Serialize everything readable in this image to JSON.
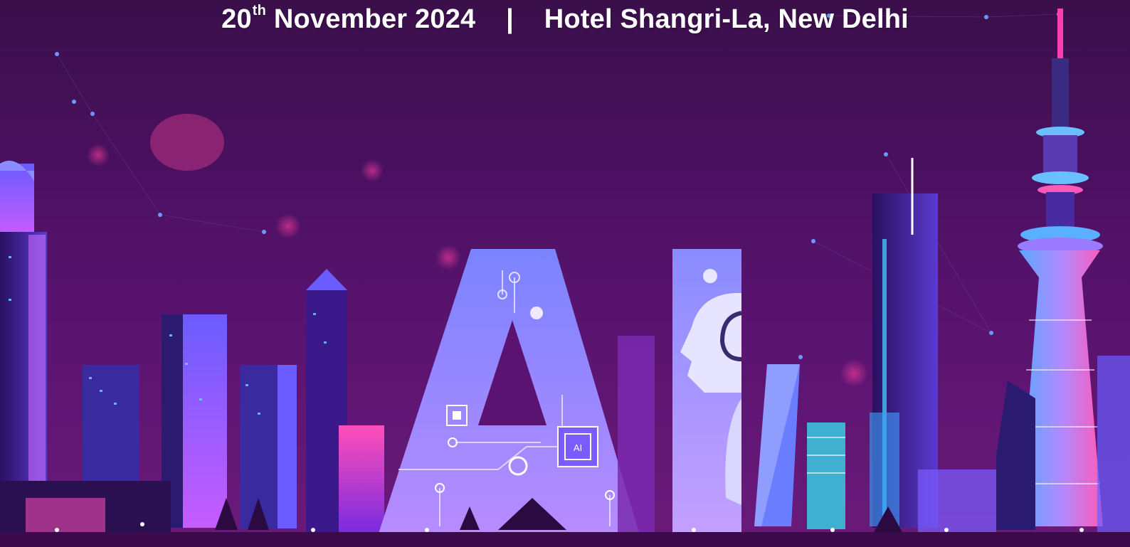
{
  "banner": {
    "date_day": "20",
    "date_suffix": "th",
    "date_rest": "November 2024",
    "separator": "|",
    "venue": "Hotel Shangri-La, New Delhi"
  },
  "artwork": {
    "big_letters": "AI",
    "chip_label": "AI"
  },
  "colors": {
    "bg_top": "#3a0f4a",
    "bg_bottom": "#6a1b7a",
    "neon_pink": "#ff3fb0",
    "neon_blue": "#6a7cff",
    "neon_cyan": "#3fe0ff"
  }
}
